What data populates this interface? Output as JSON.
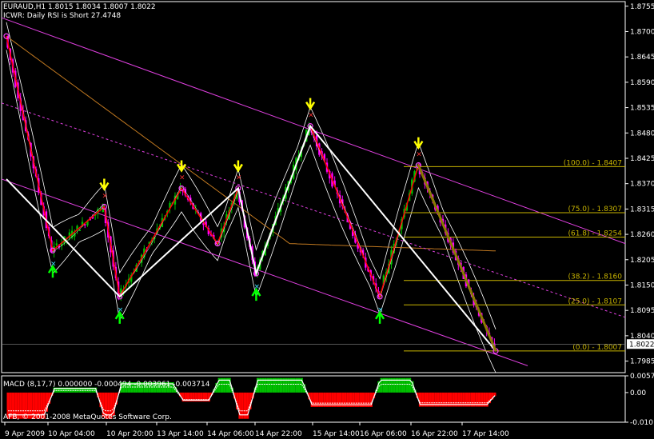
{
  "header": {
    "symbol_line": "EURAUD,H1  1.8015 1.8034 1.8007 1.8022",
    "comment_line": "ICWR: Daily RSI is Short 27.4748"
  },
  "macd_panel": {
    "label": "MACD  (8,17,7) 0.000000 -0.000494 -0.003961 -0.003714",
    "ticks": [
      {
        "value": 0.00574,
        "text": "0.00574"
      },
      {
        "value": 0.0,
        "text": "0.00"
      },
      {
        "value": -0.01017,
        "text": "-0.01017"
      }
    ]
  },
  "footer": {
    "copyright": "AFB, © 2001-2008 MetaQuotes Software Corp."
  },
  "colors": {
    "background": "#000000",
    "bull": "#00c000",
    "bear": "#ff00ff",
    "zigzag": "#ff0000",
    "wave": "#ffffff",
    "channel": "#e040e0",
    "fib": "#c8b400",
    "ma_slow": "#c07820",
    "bands": "#ffffff",
    "arrow_down": "#ffff00",
    "arrow_up": "#00ff00",
    "marker_x_red": "#ff3030",
    "marker_x_cyan": "#40e0ff",
    "macd_pos": "#00c000",
    "macd_neg": "#ff0000"
  },
  "chart_data": {
    "type": "candlestick",
    "y_ticks": [
      "1.8755",
      "1.8700",
      "1.8645",
      "1.8590",
      "1.8535",
      "1.8480",
      "1.8425",
      "1.8370",
      "1.8315",
      "1.8260",
      "1.8205",
      "1.8150",
      "1.8095",
      "1.8040",
      "1.7985"
    ],
    "x_ticks": [
      "9 Apr 2009",
      "10 Apr 04:00",
      "10 Apr 20:00",
      "13 Apr 14:00",
      "14 Apr 06:00",
      "14 Apr 22:00",
      "15 Apr 14:00",
      "16 Apr 06:00",
      "16 Apr 22:00",
      "17 Apr 14:00"
    ],
    "last_price": "1.8022",
    "ylim": [
      1.796,
      1.8765
    ],
    "bars": 190,
    "zigzag": [
      {
        "bar": 0,
        "price": 1.869
      },
      {
        "bar": 18,
        "price": 1.8225
      },
      {
        "bar": 38,
        "price": 1.832
      },
      {
        "bar": 44,
        "price": 1.8125
      },
      {
        "bar": 68,
        "price": 1.836
      },
      {
        "bar": 82,
        "price": 1.824
      },
      {
        "bar": 90,
        "price": 1.836
      },
      {
        "bar": 97,
        "price": 1.8175
      },
      {
        "bar": 118,
        "price": 1.8495
      },
      {
        "bar": 145,
        "price": 1.8125
      },
      {
        "bar": 160,
        "price": 1.841
      },
      {
        "bar": 190,
        "price": 1.8007
      }
    ],
    "fib_levels": [
      {
        "text": "(100.0) - 1.8407",
        "price": 1.8407
      },
      {
        "text": "(75.0) - 1.8307",
        "price": 1.8307
      },
      {
        "text": "(61.8) - 1.8254",
        "price": 1.8254
      },
      {
        "text": "(38.2) - 1.8160",
        "price": 1.816
      },
      {
        "text": "(25.0) - 1.8107",
        "price": 1.8107
      },
      {
        "text": "(0.0) - 1.8007",
        "price": 1.8007
      }
    ]
  }
}
